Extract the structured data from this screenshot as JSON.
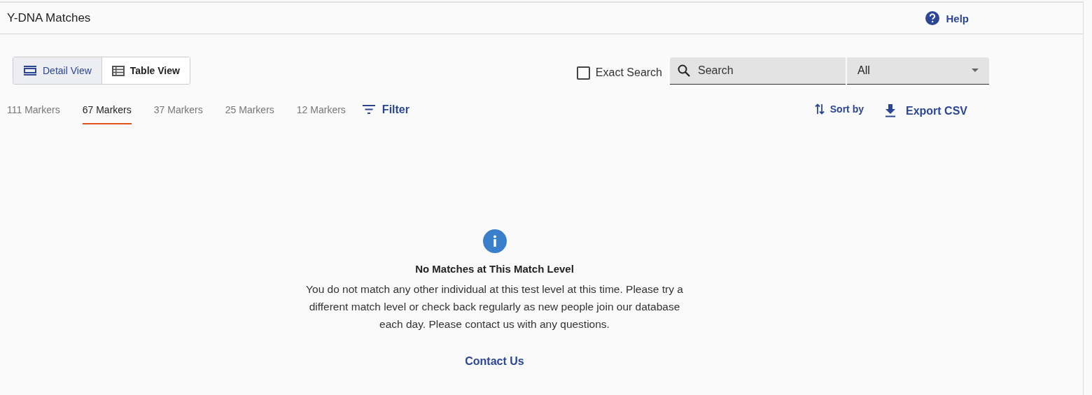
{
  "header": {
    "title": "Y-DNA Matches",
    "help": "Help"
  },
  "view_toggle": [
    {
      "label": "Detail View",
      "kind": "detail",
      "selected": true
    },
    {
      "label": "Table View",
      "kind": "table",
      "selected": false
    }
  ],
  "exact_search": {
    "label": "Exact Search",
    "checked": false
  },
  "search": {
    "placeholder": "Search"
  },
  "scope_select": {
    "value": "All"
  },
  "marker_tabs": [
    {
      "label": "111 Markers",
      "selected": false
    },
    {
      "label": "67 Markers",
      "selected": true
    },
    {
      "label": "37 Markers",
      "selected": false
    },
    {
      "label": "25 Markers",
      "selected": false
    },
    {
      "label": "12 Markers",
      "selected": false
    }
  ],
  "filter": "Filter",
  "sort_by": "Sort by",
  "export": "Export CSV",
  "empty_state": {
    "title": "No Matches at This Match Level",
    "message": "You do not match any other individual at this test level at this time. Please try a different match level or check back regularly as new people join our database each day. Please contact us with any questions.",
    "link": "Contact Us"
  }
}
